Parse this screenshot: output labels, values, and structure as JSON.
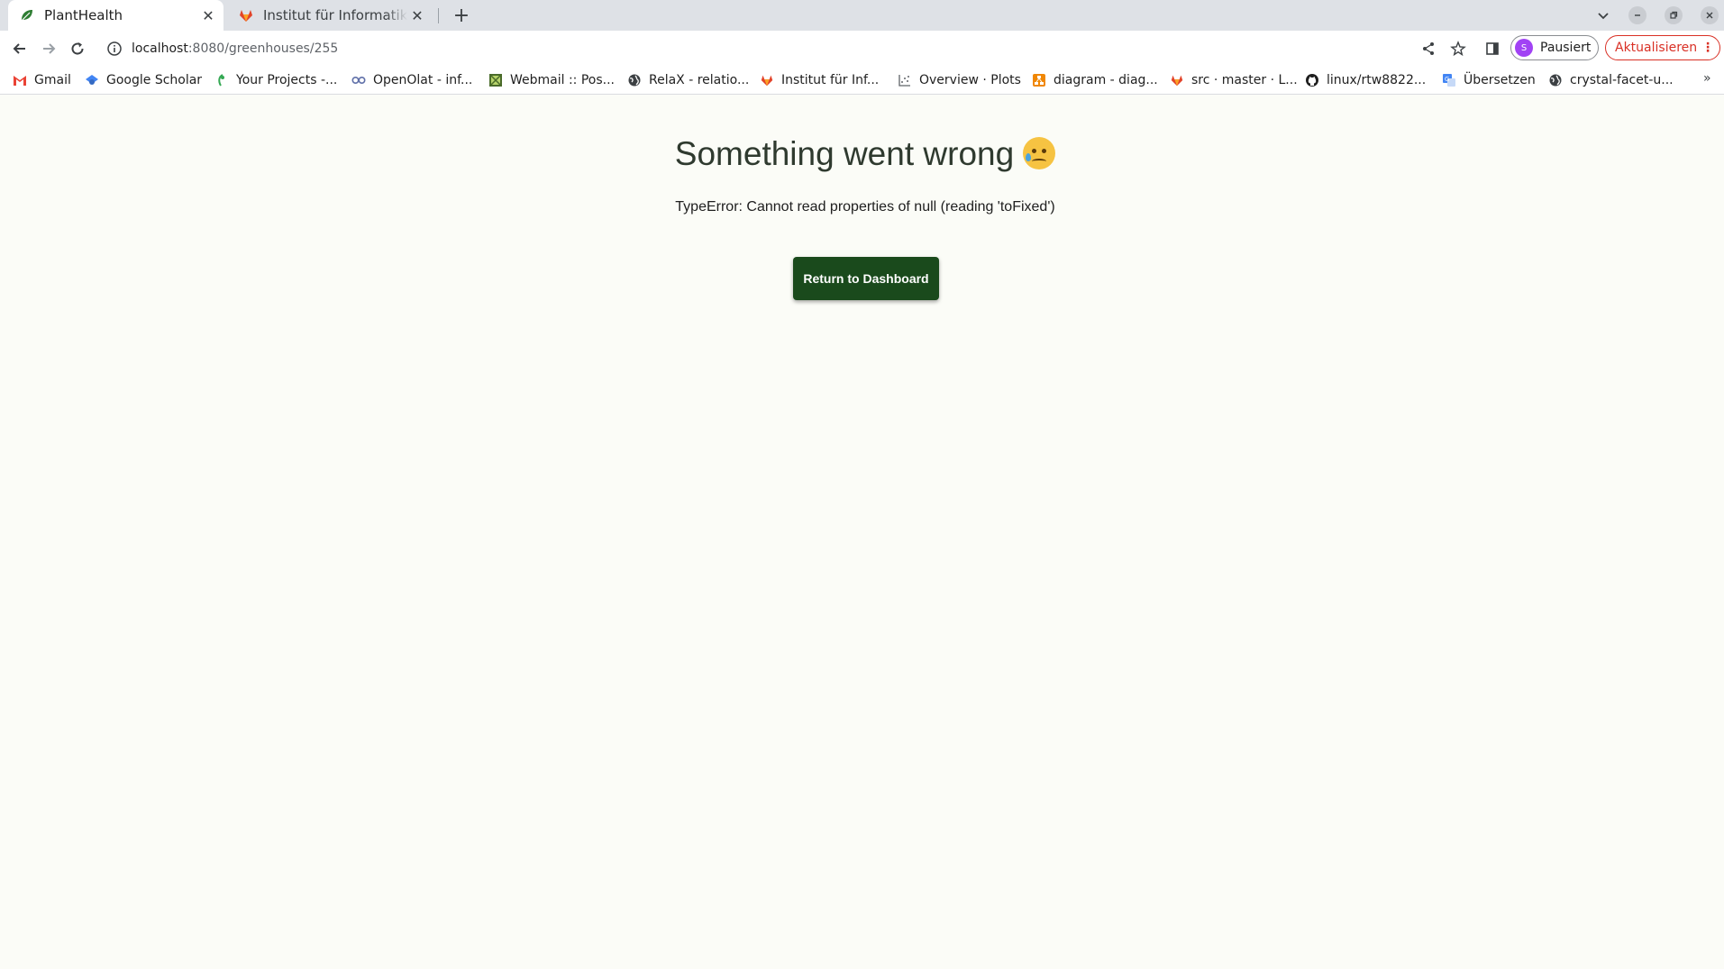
{
  "browser": {
    "tabs": [
      {
        "title": "PlantHealth",
        "active": true,
        "favicon": "plant-leaf-icon"
      },
      {
        "title": "Institut für Informatik / Gi",
        "active": false,
        "favicon": "gitlab-icon"
      }
    ],
    "new_tab": "+",
    "address": {
      "host": "localhost",
      "path": ":8080/greenhouses/255"
    },
    "profile": {
      "initial": "S",
      "label": "Pausiert"
    },
    "update_label": "Aktualisieren",
    "bookmarks": [
      {
        "label": "Gmail",
        "icon": "gmail-icon"
      },
      {
        "label": "Google Scholar",
        "icon": "scholar-icon"
      },
      {
        "label": "Your Projects -...",
        "icon": "projects-icon"
      },
      {
        "label": "OpenOlat - inf...",
        "icon": "openolat-icon"
      },
      {
        "label": "Webmail :: Pos...",
        "icon": "webmail-icon"
      },
      {
        "label": "RelaX - relatio...",
        "icon": "globe-icon"
      },
      {
        "label": "Institut für Inf...",
        "icon": "gitlab-icon"
      },
      {
        "label": "Overview · Plots",
        "icon": "plots-icon"
      },
      {
        "label": "diagram - diag...",
        "icon": "diagram-icon"
      },
      {
        "label": "src · master · L...",
        "icon": "gitlab-icon"
      },
      {
        "label": "linux/rtw8822...",
        "icon": "github-icon"
      },
      {
        "label": "Übersetzen",
        "icon": "translate-icon"
      },
      {
        "label": "crystal-facet-u...",
        "icon": "globe-icon"
      }
    ],
    "bookmarks_more": "»"
  },
  "page": {
    "title": "Something went wrong",
    "emoji": "crying-face",
    "error_message": "TypeError: Cannot read properties of null (reading 'toFixed')",
    "button_label": "Return to Dashboard"
  },
  "colors": {
    "page_background": "#fbfcf7",
    "button_background": "#1a4a1c",
    "update_red": "#d93025"
  }
}
